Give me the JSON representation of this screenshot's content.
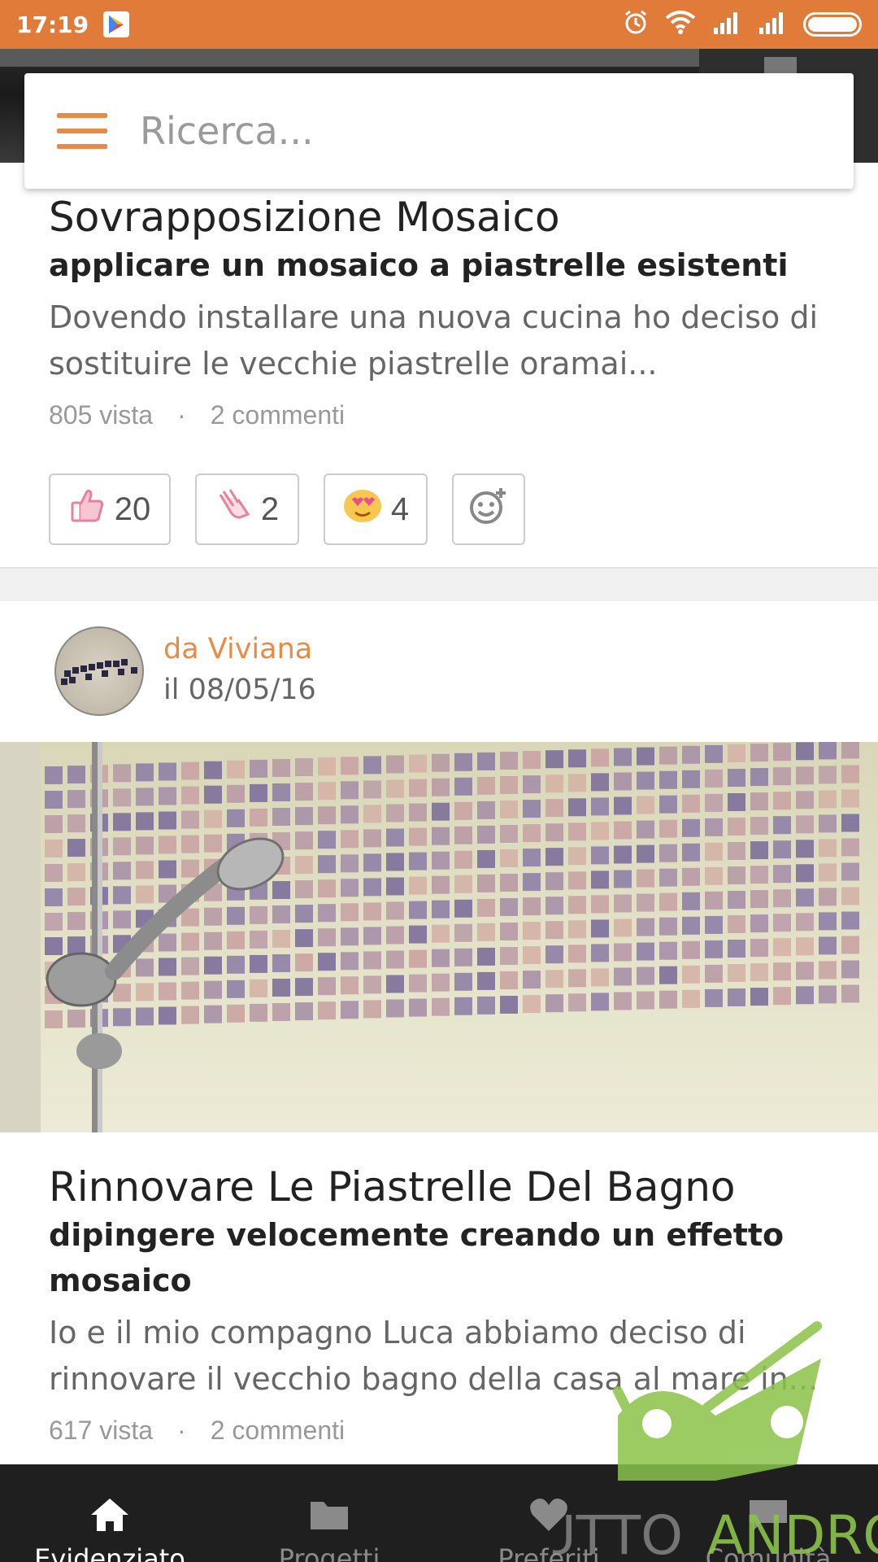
{
  "status_bar": {
    "time": "17:19",
    "icons": [
      "play-store-icon",
      "alarm-icon",
      "wifi-icon",
      "signal-icon",
      "signal-icon",
      "battery-icon"
    ]
  },
  "search": {
    "placeholder": "Ricerca..."
  },
  "articles": [
    {
      "title": "Sovrapposizione Mosaico",
      "subtitle": "applicare un mosaico a piastrelle esistenti",
      "excerpt": "Dovendo installare una nuova cucina ho deciso di sostituire le vecchie piastrelle oramai...",
      "views": "805 vista",
      "separator": "·",
      "comments": "2 commenti",
      "reactions": [
        {
          "icon": "thumbs-up-icon",
          "count": "20"
        },
        {
          "icon": "clapping-hands-icon",
          "count": "2"
        },
        {
          "icon": "heart-eyes-icon",
          "count": "4"
        },
        {
          "icon": "add-reaction-icon",
          "count": ""
        }
      ]
    },
    {
      "author": "da Viviana",
      "date": "il 08/05/16",
      "title": "Rinnovare Le Piastrelle Del Bagno",
      "subtitle": "dipingere velocemente creando un effetto mosaico",
      "excerpt": "Io e il mio compagno Luca abbiamo deciso di rinnovare il vecchio bagno della casa al mare in...",
      "views": "617 vista",
      "separator": "·",
      "comments": "2 commenti"
    }
  ],
  "bottom_nav": [
    {
      "label": "Evidenziato",
      "icon": "home-icon",
      "active": true
    },
    {
      "label": "Progetti",
      "icon": "folder-icon",
      "active": false
    },
    {
      "label": "Preferiti",
      "icon": "heart-icon",
      "active": false
    },
    {
      "label": "Comunità",
      "icon": "chat-icon",
      "active": false
    }
  ],
  "watermark": {
    "text_1": "TUTTO",
    "text_2": "ANDROID"
  },
  "colors": {
    "accent": "#e98b48",
    "status_bar": "#e07b3a",
    "nav_bg": "#1f1f1f",
    "watermark": "#8bc34a"
  }
}
